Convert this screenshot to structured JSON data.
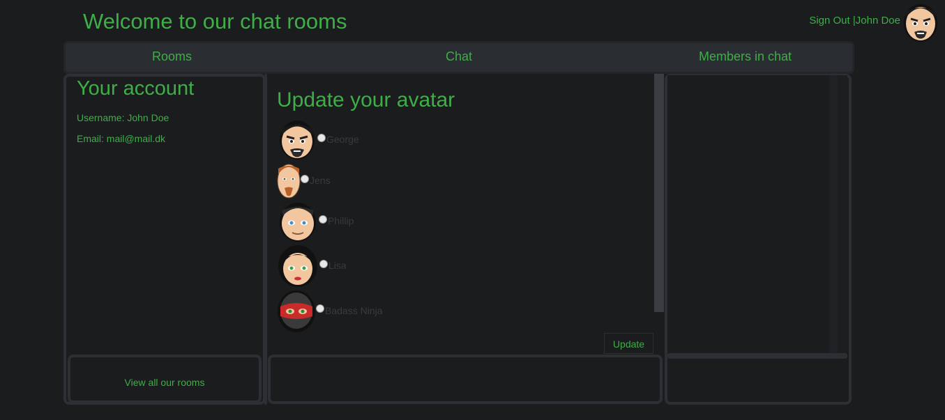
{
  "header": {
    "title": "Welcome to our chat rooms",
    "sign_out": "Sign Out",
    "separator": " |",
    "username": "John Doe"
  },
  "nav": {
    "rooms": "Rooms",
    "chat": "Chat",
    "members": "Members in chat"
  },
  "account": {
    "title": "Your account",
    "username_line": "Username: John Doe",
    "email_line": "Email: mail@mail.dk",
    "view_rooms": "View all our rooms"
  },
  "avatar_form": {
    "title": "Update your avatar",
    "options": [
      {
        "name": "George"
      },
      {
        "name": "Jens"
      },
      {
        "name": "Phillip"
      },
      {
        "name": "Lisa"
      },
      {
        "name": "Badass Ninja"
      }
    ],
    "update_label": "Update"
  },
  "colors": {
    "accent": "#3fae49",
    "background": "#1b1c1e",
    "panel_border": "#2c2f33"
  }
}
